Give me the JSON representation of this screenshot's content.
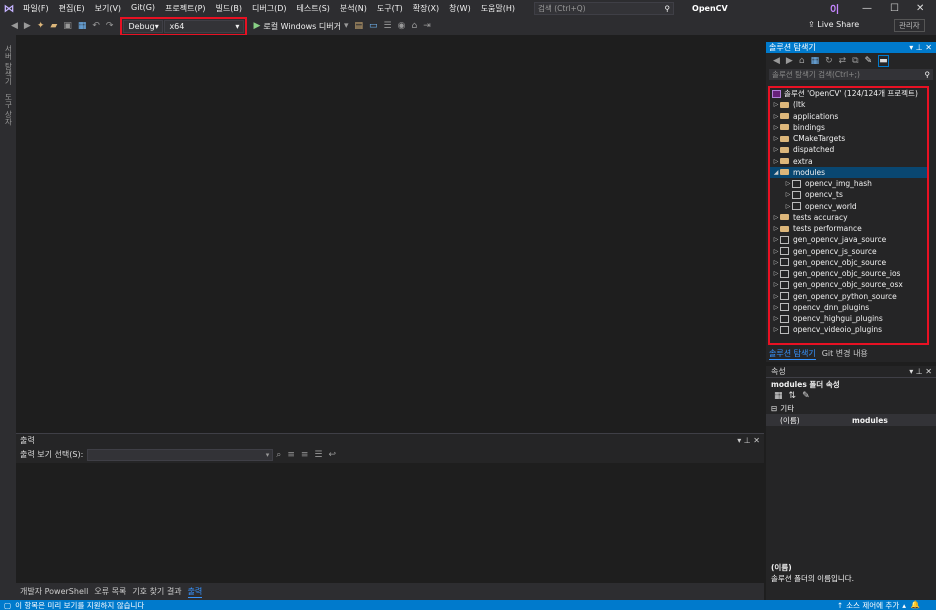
{
  "menubar": {
    "items": [
      "파일(F)",
      "편집(E)",
      "보기(V)",
      "Git(G)",
      "프로젝트(P)",
      "빌드(B)",
      "디버그(D)",
      "테스트(S)",
      "분석(N)",
      "도구(T)",
      "확장(X)",
      "창(W)",
      "도움말(H)"
    ],
    "search_placeholder": "검색 (Ctrl+Q)",
    "title": "OpenCV",
    "user_initial": "이"
  },
  "toolbar": {
    "config": "Debug",
    "platform": "x64",
    "debugger": "로컬 Windows 디버거",
    "live_share": "Live Share",
    "admin": "관리자"
  },
  "left_strip": {
    "tabs": [
      "서버 탐색기",
      "도구 상자"
    ]
  },
  "output": {
    "title": "출력",
    "show_from_label": "출력 보기 선택(S):"
  },
  "bottom_tabs": [
    "개발자 PowerShell",
    "오류 목록",
    "기호 찾기 결과",
    "출력"
  ],
  "statusbar": {
    "left": "이 항목은 미리 보기를 지원하지 않습니다",
    "right": "소스 제어에 추가"
  },
  "solution_explorer": {
    "title": "솔루션 탐색기",
    "search_placeholder": "솔루션 탐색기 검색(Ctrl+;)",
    "solution_label": "솔루션 'OpenCV' (124/124개 프로젝트)",
    "items": [
      {
        "label": "(ltk",
        "type": "folder",
        "indent": 0,
        "arrow": "▷"
      },
      {
        "label": "applications",
        "type": "folder",
        "indent": 0,
        "arrow": "▷"
      },
      {
        "label": "bindings",
        "type": "folder",
        "indent": 0,
        "arrow": "▷"
      },
      {
        "label": "CMakeTargets",
        "type": "folder",
        "indent": 0,
        "arrow": "▷"
      },
      {
        "label": "dispatched",
        "type": "folder",
        "indent": 0,
        "arrow": "▷"
      },
      {
        "label": "extra",
        "type": "folder",
        "indent": 0,
        "arrow": "▷"
      },
      {
        "label": "modules",
        "type": "folder",
        "indent": 0,
        "arrow": "◢",
        "selected": true
      },
      {
        "label": "opencv_img_hash",
        "type": "project",
        "indent": 1,
        "arrow": "▷"
      },
      {
        "label": "opencv_ts",
        "type": "project",
        "indent": 1,
        "arrow": "▷"
      },
      {
        "label": "opencv_world",
        "type": "project",
        "indent": 1,
        "arrow": "▷"
      },
      {
        "label": "tests accuracy",
        "type": "folder",
        "indent": 0,
        "arrow": "▷"
      },
      {
        "label": "tests performance",
        "type": "folder",
        "indent": 0,
        "arrow": "▷"
      },
      {
        "label": "gen_opencv_java_source",
        "type": "project",
        "indent": 0,
        "arrow": "▷"
      },
      {
        "label": "gen_opencv_js_source",
        "type": "project",
        "indent": 0,
        "arrow": "▷"
      },
      {
        "label": "gen_opencv_objc_source",
        "type": "project",
        "indent": 0,
        "arrow": "▷"
      },
      {
        "label": "gen_opencv_objc_source_ios",
        "type": "project",
        "indent": 0,
        "arrow": "▷"
      },
      {
        "label": "gen_opencv_objc_source_osx",
        "type": "project",
        "indent": 0,
        "arrow": "▷"
      },
      {
        "label": "gen_opencv_python_source",
        "type": "project",
        "indent": 0,
        "arrow": "▷"
      },
      {
        "label": "opencv_dnn_plugins",
        "type": "project",
        "indent": 0,
        "arrow": "▷"
      },
      {
        "label": "opencv_highgui_plugins",
        "type": "project",
        "indent": 0,
        "arrow": "▷"
      },
      {
        "label": "opencv_videoio_plugins",
        "type": "project",
        "indent": 0,
        "arrow": "▷"
      }
    ],
    "tabs": [
      "솔루션 탐색기",
      "Git 변경 내용"
    ]
  },
  "properties": {
    "title": "속성",
    "subject": "modules 폴더 속성",
    "category": "기타",
    "name_key": "(이름)",
    "name_value": "modules",
    "desc_title": "(이름)",
    "desc_text": "솔루션 폴더의 이름입니다."
  },
  "colors": {
    "accent": "#007acc",
    "highlight": "#e81123",
    "selection": "#094771"
  }
}
